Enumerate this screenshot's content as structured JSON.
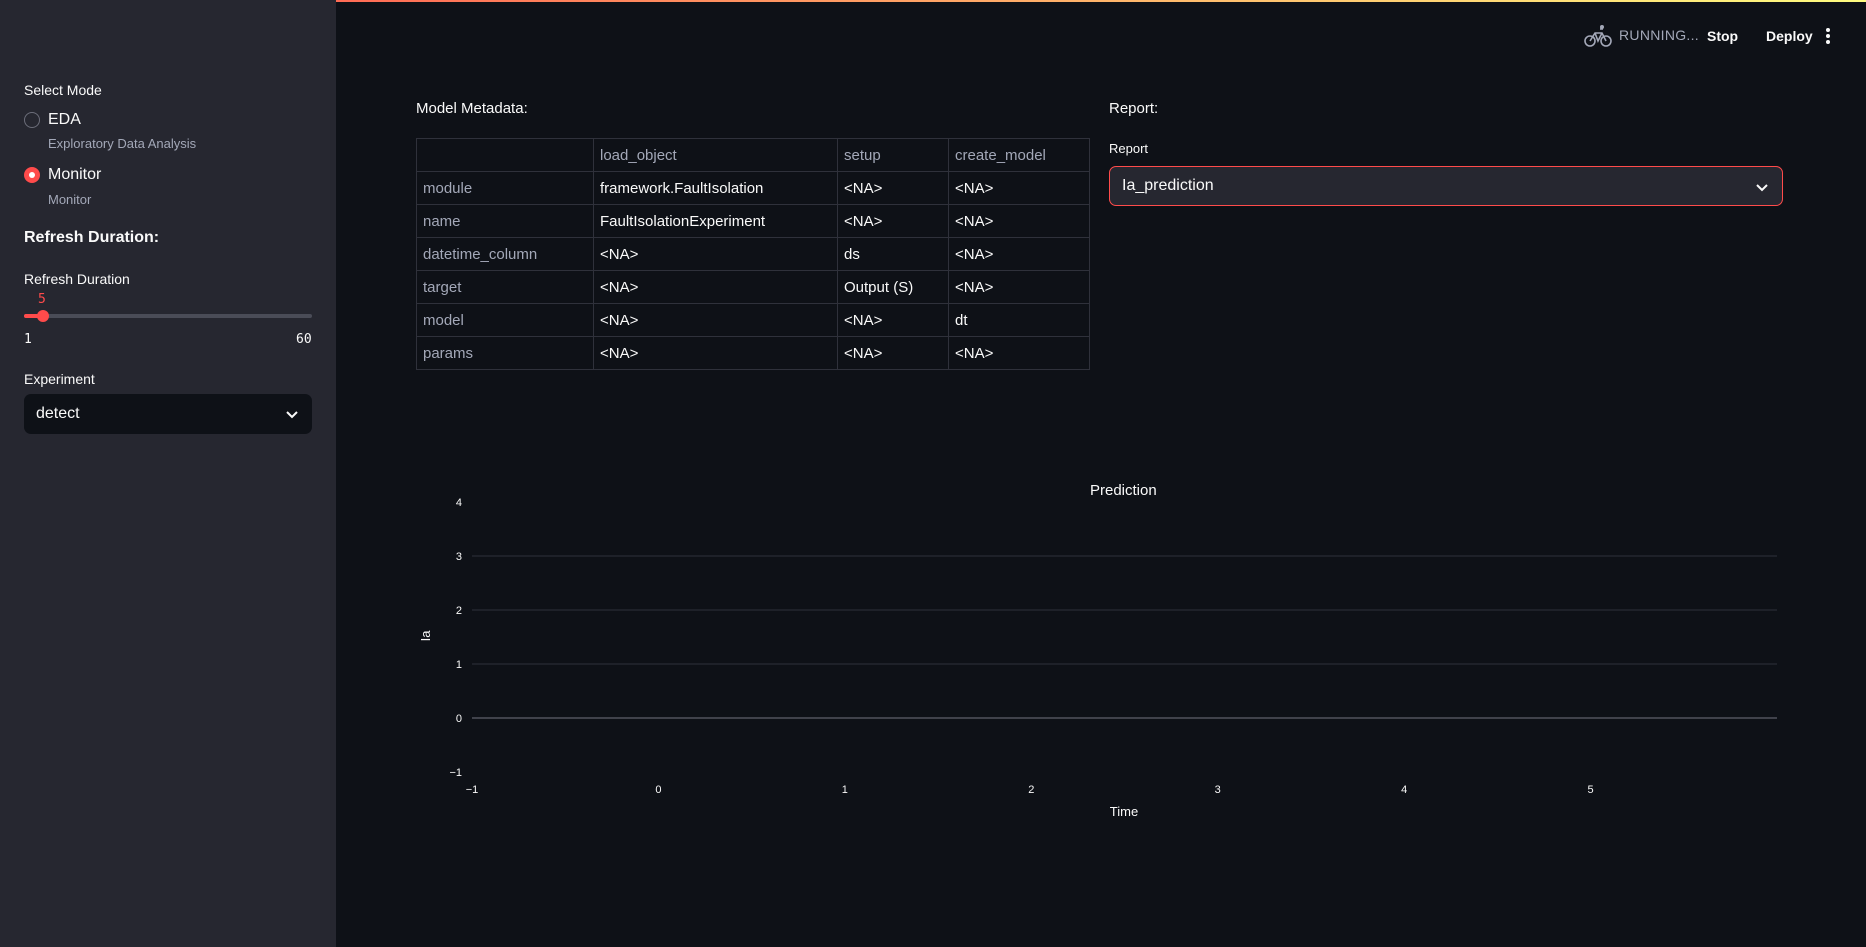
{
  "header": {
    "status": "RUNNING...",
    "stop_label": "Stop",
    "deploy_label": "Deploy"
  },
  "sidebar": {
    "mode_label": "Select Mode",
    "modes": [
      {
        "label": "EDA",
        "caption": "Exploratory Data Analysis",
        "selected": false
      },
      {
        "label": "Monitor",
        "caption": "Monitor",
        "selected": true
      }
    ],
    "refresh_heading": "Refresh Duration:",
    "refresh_label": "Refresh Duration",
    "refresh_value": "5",
    "refresh_min": "1",
    "refresh_max": "60",
    "experiment_label": "Experiment",
    "experiment_value": "detect"
  },
  "metadata": {
    "heading": "Model Metadata:",
    "columns": [
      "",
      "load_object",
      "setup",
      "create_model"
    ],
    "rows": [
      [
        "module",
        "framework.FaultIsolation",
        "<NA>",
        "<NA>"
      ],
      [
        "name",
        "FaultIsolationExperiment",
        "<NA>",
        "<NA>"
      ],
      [
        "datetime_column",
        "<NA>",
        "ds",
        "<NA>"
      ],
      [
        "target",
        "<NA>",
        "Output (S)",
        "<NA>"
      ],
      [
        "model",
        "<NA>",
        "<NA>",
        "dt"
      ],
      [
        "params",
        "<NA>",
        "<NA>",
        "<NA>"
      ]
    ]
  },
  "report": {
    "heading": "Report:",
    "label": "Report",
    "value": "Ia_prediction"
  },
  "chart_data": {
    "type": "line",
    "title": "Prediction",
    "xlabel": "Time",
    "ylabel": "Ia",
    "xlim": [
      -1,
      6
    ],
    "ylim": [
      -1,
      4
    ],
    "x_ticks": [
      "−1",
      "0",
      "1",
      "2",
      "3",
      "4",
      "5"
    ],
    "y_ticks": [
      "4",
      "3",
      "2",
      "1",
      "0",
      "−1"
    ],
    "series": [],
    "grid": true
  },
  "colors": {
    "accent": "#ff4b4b",
    "background": "#0e1117",
    "sidebar": "#262730"
  }
}
